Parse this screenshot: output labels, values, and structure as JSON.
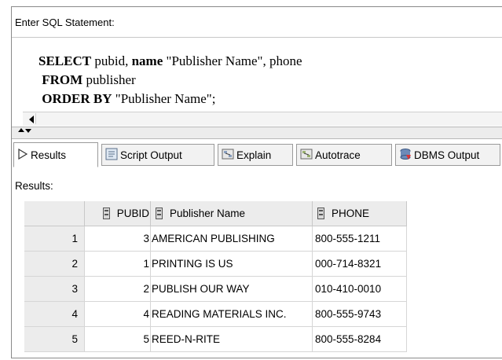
{
  "editor": {
    "label": "Enter SQL Statement:",
    "line1_kw": "SELECT",
    "line1_rest1": " pubid, ",
    "line1_kw2": "name",
    "line1_rest2": " \"Publisher Name\", phone",
    "line2_kw": "FROM",
    "line2_rest": " publisher",
    "line3_kw": "ORDER BY",
    "line3_rest": " \"Publisher Name\";"
  },
  "tabs": [
    {
      "label": "Results",
      "icon": "results-arrow-icon"
    },
    {
      "label": "Script Output",
      "icon": "script-icon"
    },
    {
      "label": "Explain",
      "icon": "explain-icon"
    },
    {
      "label": "Autotrace",
      "icon": "autotrace-icon"
    },
    {
      "label": "DBMS Output",
      "icon": "dbms-icon"
    }
  ],
  "results_label": "Results:",
  "columns": [
    "PUBID",
    "Publisher Name",
    "PHONE"
  ],
  "rows": [
    {
      "n": "1",
      "pubid": "3",
      "name": "AMERICAN PUBLISHING",
      "phone": "800-555-1211"
    },
    {
      "n": "2",
      "pubid": "1",
      "name": "PRINTING IS US",
      "phone": "000-714-8321"
    },
    {
      "n": "3",
      "pubid": "2",
      "name": "PUBLISH OUR WAY",
      "phone": "010-410-0010"
    },
    {
      "n": "4",
      "pubid": "4",
      "name": "READING MATERIALS INC.",
      "phone": "800-555-9743"
    },
    {
      "n": "5",
      "pubid": "5",
      "name": "REED-N-RITE",
      "phone": "800-555-8284"
    }
  ]
}
